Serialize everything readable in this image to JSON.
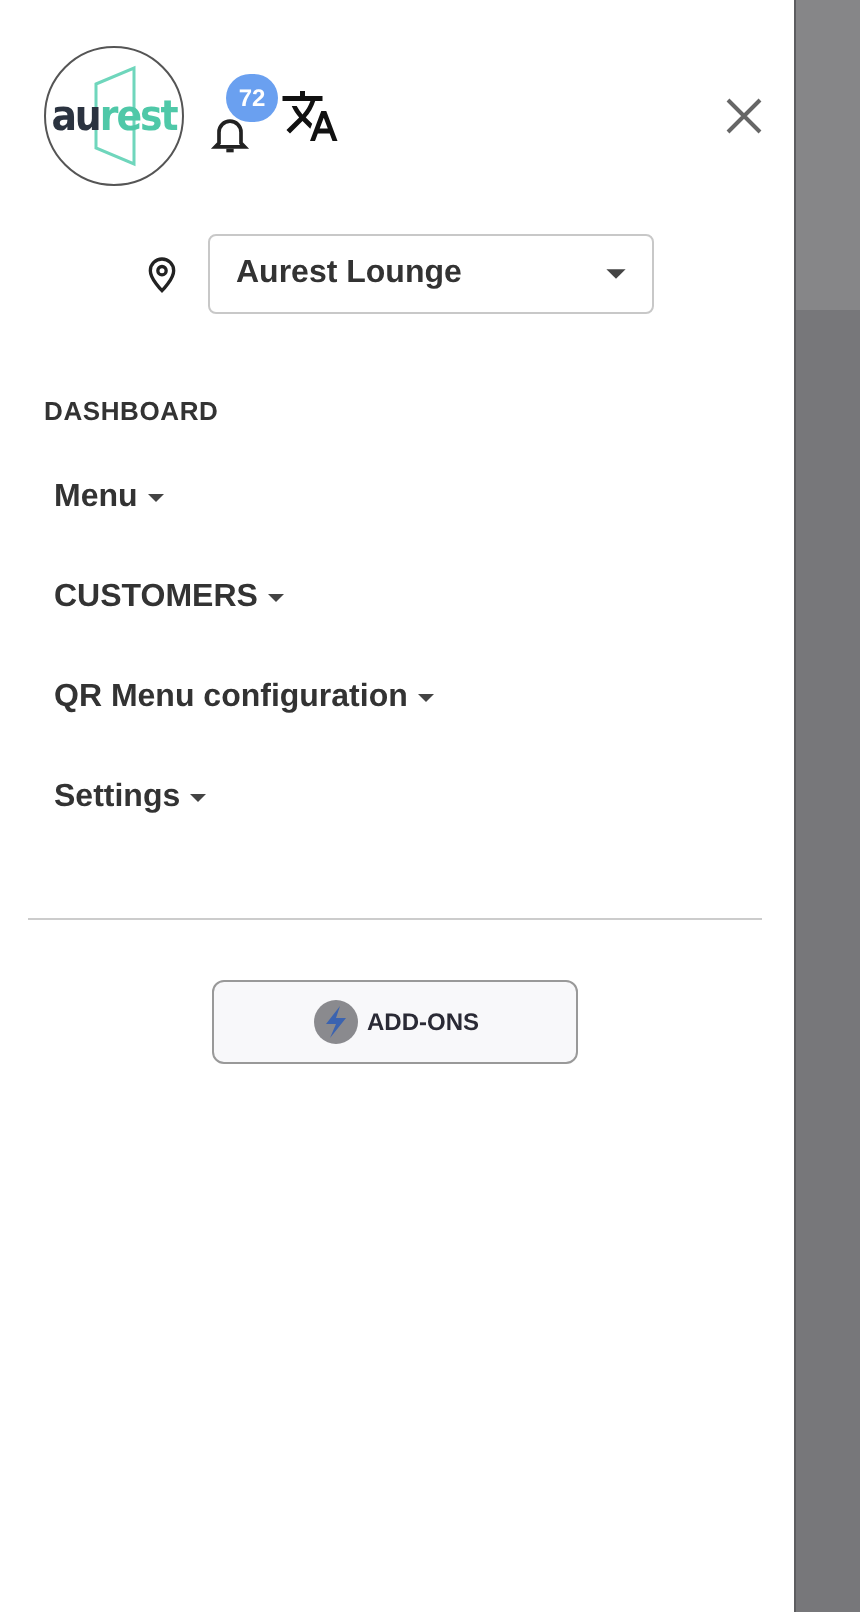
{
  "logo": {
    "dark_text": "au",
    "accent_text": "rest"
  },
  "notifications": {
    "count": "72"
  },
  "location": {
    "value": "Aurest Lounge"
  },
  "section_title": "DASHBOARD",
  "nav_items": [
    {
      "label": "Menu",
      "expanded": false
    },
    {
      "label": "CUSTOMERS",
      "expanded": false
    },
    {
      "label": "QR Menu configuration",
      "expanded": false
    },
    {
      "label": "Settings",
      "expanded": false
    }
  ],
  "addons_button": {
    "label": "ADD-ONS"
  }
}
